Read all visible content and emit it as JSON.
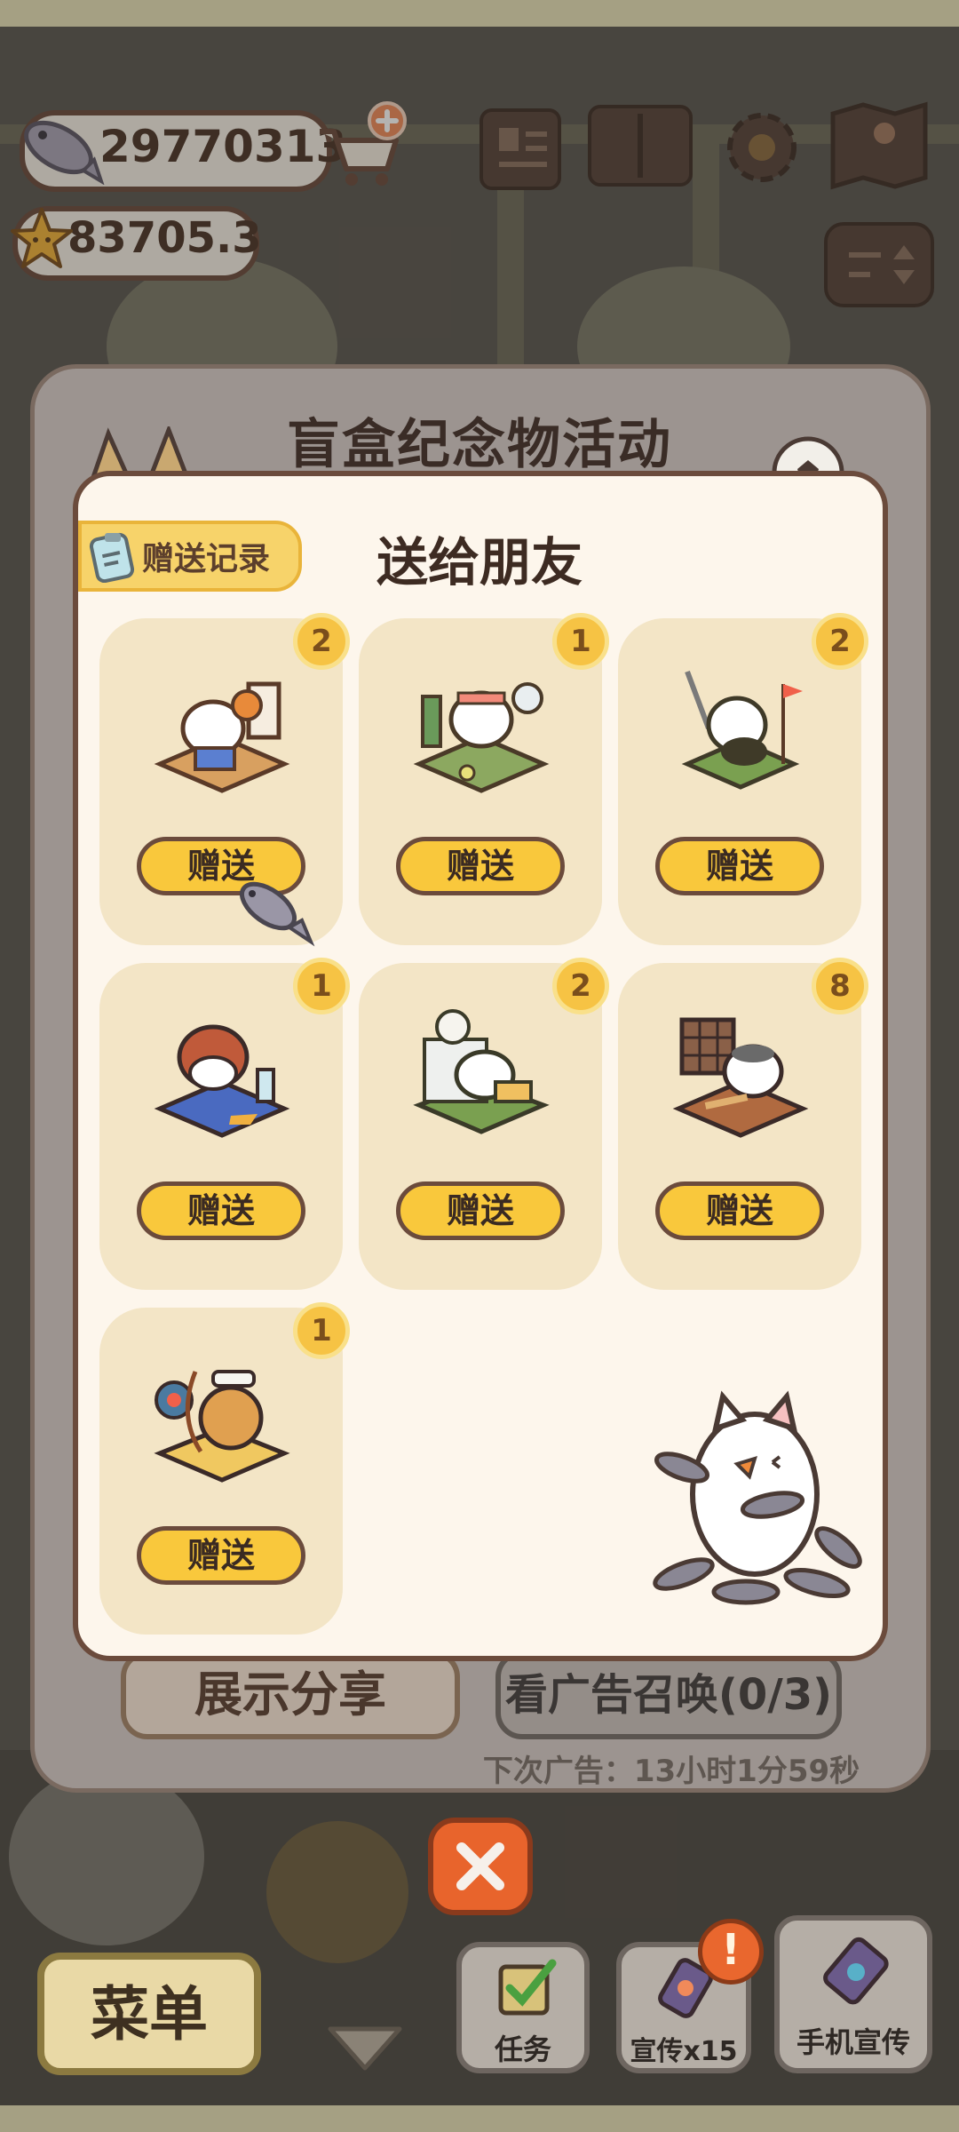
{
  "currency": {
    "fish": "29770313",
    "stars": "83705.3",
    "fish_icon": "fish-icon",
    "star_icon": "star-icon",
    "shop_icon": "shop-cart-plus-icon"
  },
  "top_icons": [
    "news-icon",
    "book-icon",
    "gear-icon",
    "map-icon",
    "sort-icon"
  ],
  "event": {
    "title": "盲盒纪念物活动",
    "share_label": "展示分享",
    "ad_label": "看广告召唤(0/3)",
    "ad_timer": "下次广告：13小时1分59秒"
  },
  "gift_panel": {
    "title": "送给朋友",
    "record_label": "赠送记录",
    "record_icon": "clipboard-icon",
    "items": [
      {
        "name": "basketball-cat-figure",
        "count": "2",
        "button": "赠送"
      },
      {
        "name": "tennis-cat-figure",
        "count": "1",
        "button": "赠送"
      },
      {
        "name": "golf-cat-figure",
        "count": "2",
        "button": "赠送"
      },
      {
        "name": "football-cat-figure",
        "count": "1",
        "button": "赠送"
      },
      {
        "name": "soccer-cat-figure",
        "count": "2",
        "button": "赠送"
      },
      {
        "name": "baseball-cat-figure",
        "count": "8",
        "button": "赠送"
      },
      {
        "name": "archery-cat-figure",
        "count": "1",
        "button": "赠送"
      }
    ]
  },
  "bottom_bar": {
    "menu_label": "菜单",
    "task_label": "任务",
    "promo_label": "宣传x15",
    "phone_label": "手机宣传",
    "alert": "!"
  },
  "colors": {
    "panel_bg": "#fdf6ec",
    "card_bg": "#f3e5c6",
    "button_yellow": "#f9c83c",
    "outline_brown": "#6b4b3c",
    "close_orange": "#e8642c"
  }
}
